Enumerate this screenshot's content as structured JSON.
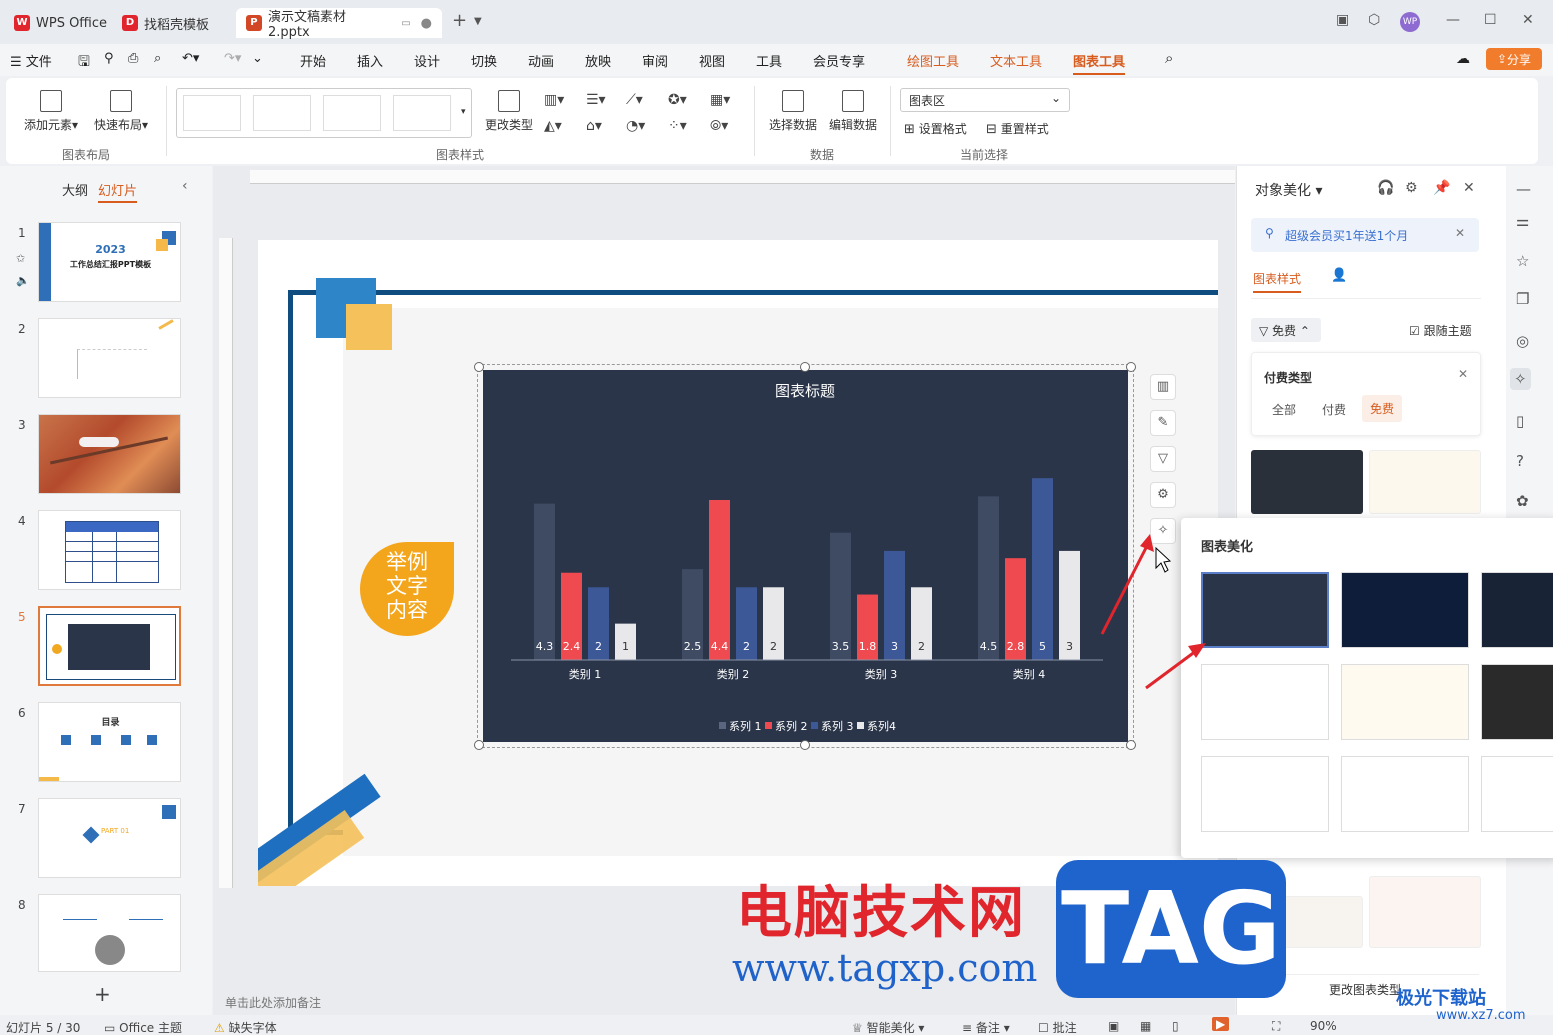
{
  "tabs": [
    {
      "label": "WPS Office",
      "color": "#e0252c"
    },
    {
      "label": "找稻壳模板",
      "color": "#e0252c"
    },
    {
      "label": "演示文稿素材2.pptx",
      "color": "#d24726"
    }
  ],
  "menu": {
    "file": "文件",
    "items": [
      "开始",
      "插入",
      "设计",
      "切换",
      "动画",
      "放映",
      "审阅",
      "视图",
      "工具",
      "会员专享"
    ],
    "context": [
      "绘图工具",
      "文本工具"
    ],
    "active": "图表工具",
    "share": "分享"
  },
  "ribbon": {
    "add_element": "添加元素",
    "quick_layout": "快速布局",
    "group_layout": "图表布局",
    "change_type": "更改类型",
    "group_style": "图表样式",
    "select_data": "选择数据",
    "edit_data": "编辑数据",
    "group_data": "数据",
    "selection_value": "图表区",
    "set_format": "设置格式",
    "reset_style": "重置样式",
    "group_current": "当前选择"
  },
  "leftpanel": {
    "outline_tab": "大纲",
    "slides_tab": "幻灯片",
    "slides": [
      {
        "num": "1",
        "title": "2023",
        "subtitle": "工作总结汇报PPT模板"
      },
      {
        "num": "2"
      },
      {
        "num": "3"
      },
      {
        "num": "4"
      },
      {
        "num": "5"
      },
      {
        "num": "6",
        "title": "目录"
      },
      {
        "num": "7",
        "title": "PART 01"
      },
      {
        "num": "8"
      }
    ],
    "add": "+"
  },
  "slide": {
    "callout": [
      "举例",
      "文字",
      "内容"
    ]
  },
  "chart_data": {
    "type": "bar",
    "title": "图表标题",
    "categories": [
      "类别 1",
      "类别 2",
      "类别 3",
      "类别 4"
    ],
    "series": [
      {
        "name": "系列 1",
        "values": [
          4.3,
          2.5,
          3.5,
          4.5
        ],
        "color": "#3f4a63"
      },
      {
        "name": "系列 2",
        "values": [
          2.4,
          4.4,
          1.8,
          2.8
        ],
        "color": "#ef4a4f"
      },
      {
        "name": "系列 3",
        "values": [
          2,
          2,
          3,
          5
        ],
        "color": "#3d5897"
      },
      {
        "name": "系列4",
        "values": [
          1,
          2,
          2,
          3
        ],
        "color": "#e8e8ea"
      }
    ],
    "ylim": [
      0,
      5.5
    ],
    "grid": false,
    "legend": "bottom"
  },
  "notes_placeholder": "单击此处添加备注",
  "rightpanel": {
    "title": "对象美化",
    "promo": "超级会员买1年送1个月",
    "tab_style": "图表样式",
    "filter": "免费",
    "follow_theme": "跟随主题",
    "paid_type_title": "付费类型",
    "paid_options": [
      "全部",
      "付费",
      "免费"
    ],
    "change_type_btn": "更改图表类型"
  },
  "beautify": {
    "title": "图表美化"
  },
  "status": {
    "slide_info": "幻灯片 5 / 30",
    "theme": "Office 主题",
    "missing_font": "缺失字体",
    "smart": "智能美化",
    "notes": "备注",
    "comments": "批注",
    "zoom": "90%"
  },
  "watermark": {
    "site": "电脑技术网",
    "url": "www.tagxp.com",
    "tag": "TAG",
    "corner": "极光下载站",
    "corner_url": "www.xz7.com"
  }
}
